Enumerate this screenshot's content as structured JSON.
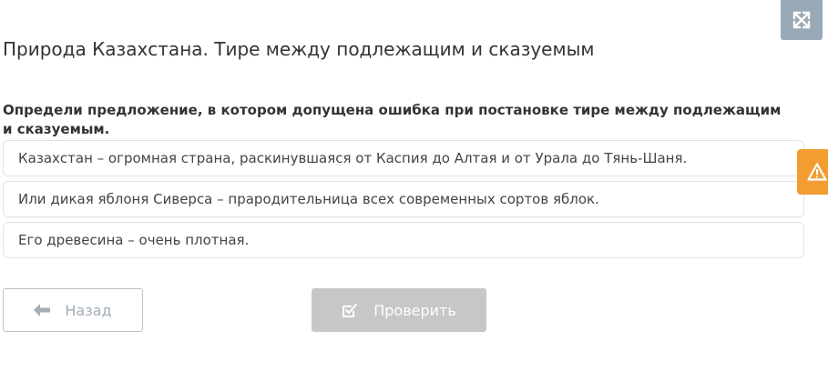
{
  "header": {
    "title": "Природа Казахстана. Тире между подлежащим и сказуемым",
    "expand_icon": "expand-arrows-icon"
  },
  "question": {
    "text": "Определи предложение, в котором допущена ошибка при постановке тире между подлежащим и сказуемым."
  },
  "options": [
    {
      "text": "Казахстан – огромная страна, раскинувшаяся от Каспия до Алтая и от Урала до Тянь-Шаня."
    },
    {
      "text": "Или дикая яблоня Сиверса – прародительница всех современных сортов яблок."
    },
    {
      "text": "Его древесина – очень плотная."
    }
  ],
  "side_tab": {
    "icon": "warning-icon",
    "color": "#f39c32"
  },
  "buttons": {
    "back_label": "Назад",
    "back_icon": "arrow-left-icon",
    "check_label": "Проверить",
    "check_icon": "checkbox-icon"
  },
  "colors": {
    "expand_bg": "#9aa9b6",
    "check_bg_disabled": "#c7c7c7",
    "back_border": "#b8c2cb"
  }
}
